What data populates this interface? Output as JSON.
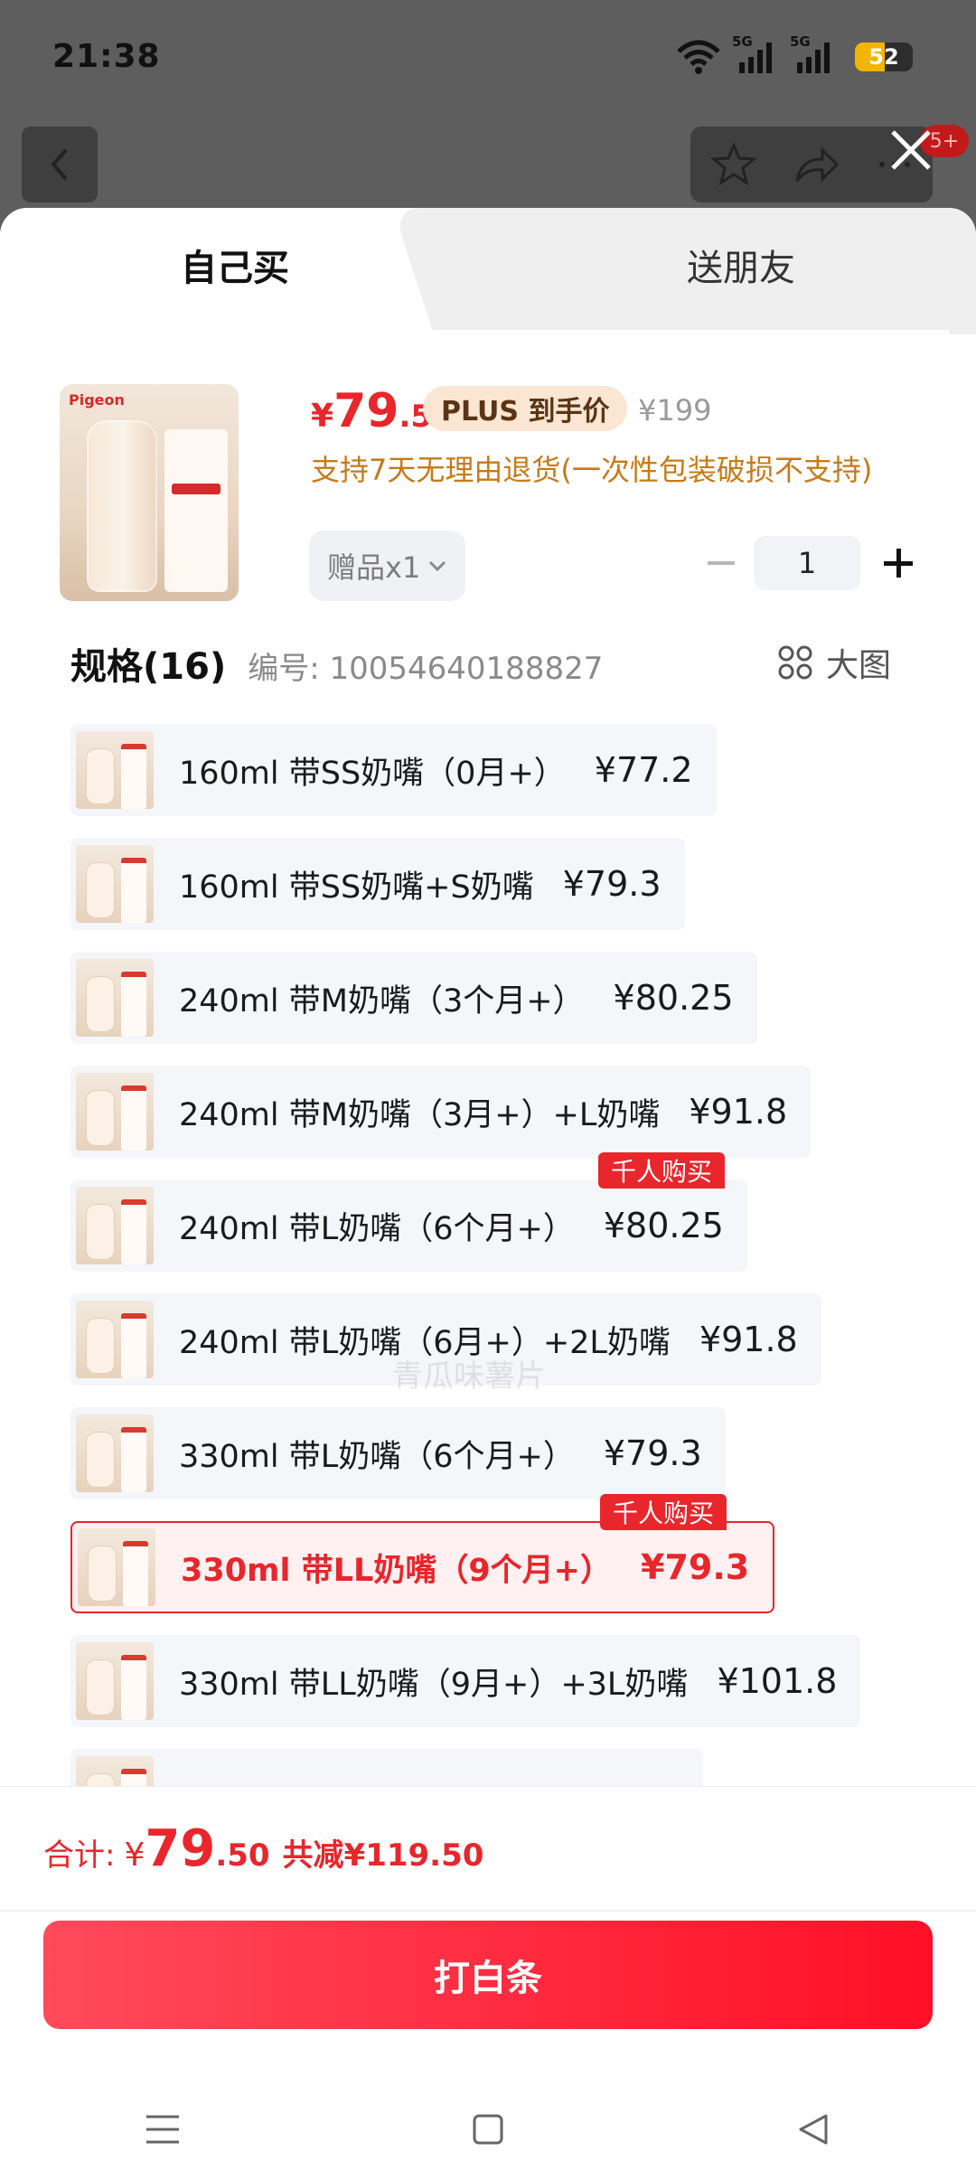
{
  "status_bar": {
    "time": "21:38",
    "network1": "5G",
    "network2": "5G",
    "battery": "52"
  },
  "tabs": {
    "self_buy": "自己买",
    "gift_friend": "送朋友"
  },
  "product": {
    "price_symbol": "¥",
    "price_int": "79",
    "price_dec": ".5",
    "plus_tag": "PLUS 到手价",
    "original_price": "¥199",
    "return_policy": "支持7天无理由退货(一次性包装破损不支持)",
    "gift_label": "赠品x1",
    "brand": "Pigeon",
    "quantity": "1"
  },
  "specs": {
    "title": "规格(16)",
    "code": "编号: 10054640188827",
    "big_image_label": "大图",
    "hot_badge": "千人购买",
    "items": [
      {
        "label": "160ml 带SS奶嘴（0月+）",
        "price": "¥77.2"
      },
      {
        "label": "160ml 带SS奶嘴+S奶嘴",
        "price": "¥79.3"
      },
      {
        "label": "240ml 带M奶嘴（3个月+）",
        "price": "¥80.25"
      },
      {
        "label": "240ml 带M奶嘴（3月+）+L奶嘴",
        "price": "¥91.8"
      },
      {
        "label": "240ml 带L奶嘴（6个月+）",
        "price": "¥80.25"
      },
      {
        "label": "240ml 带L奶嘴（6月+）+2L奶嘴",
        "price": "¥91.8"
      },
      {
        "label": "330ml 带L奶嘴（6个月+）",
        "price": "¥79.3"
      },
      {
        "label": "330ml 带LL奶嘴（9个月+）",
        "price": "¥79.3"
      },
      {
        "label": "330ml 带LL奶嘴（9月+）+3L奶嘴",
        "price": "¥101.8"
      }
    ]
  },
  "watermark": "青瓜味薯片",
  "footer": {
    "total_label": "合计:",
    "total_symbol": "¥",
    "total_int": "79",
    "total_dec": ".50",
    "savings": "共减¥119.50",
    "pay_button": "打白条"
  },
  "colors": {
    "accent": "#e8262b",
    "plus_bg": "#fbe6d4",
    "policy": "#c77a18"
  }
}
